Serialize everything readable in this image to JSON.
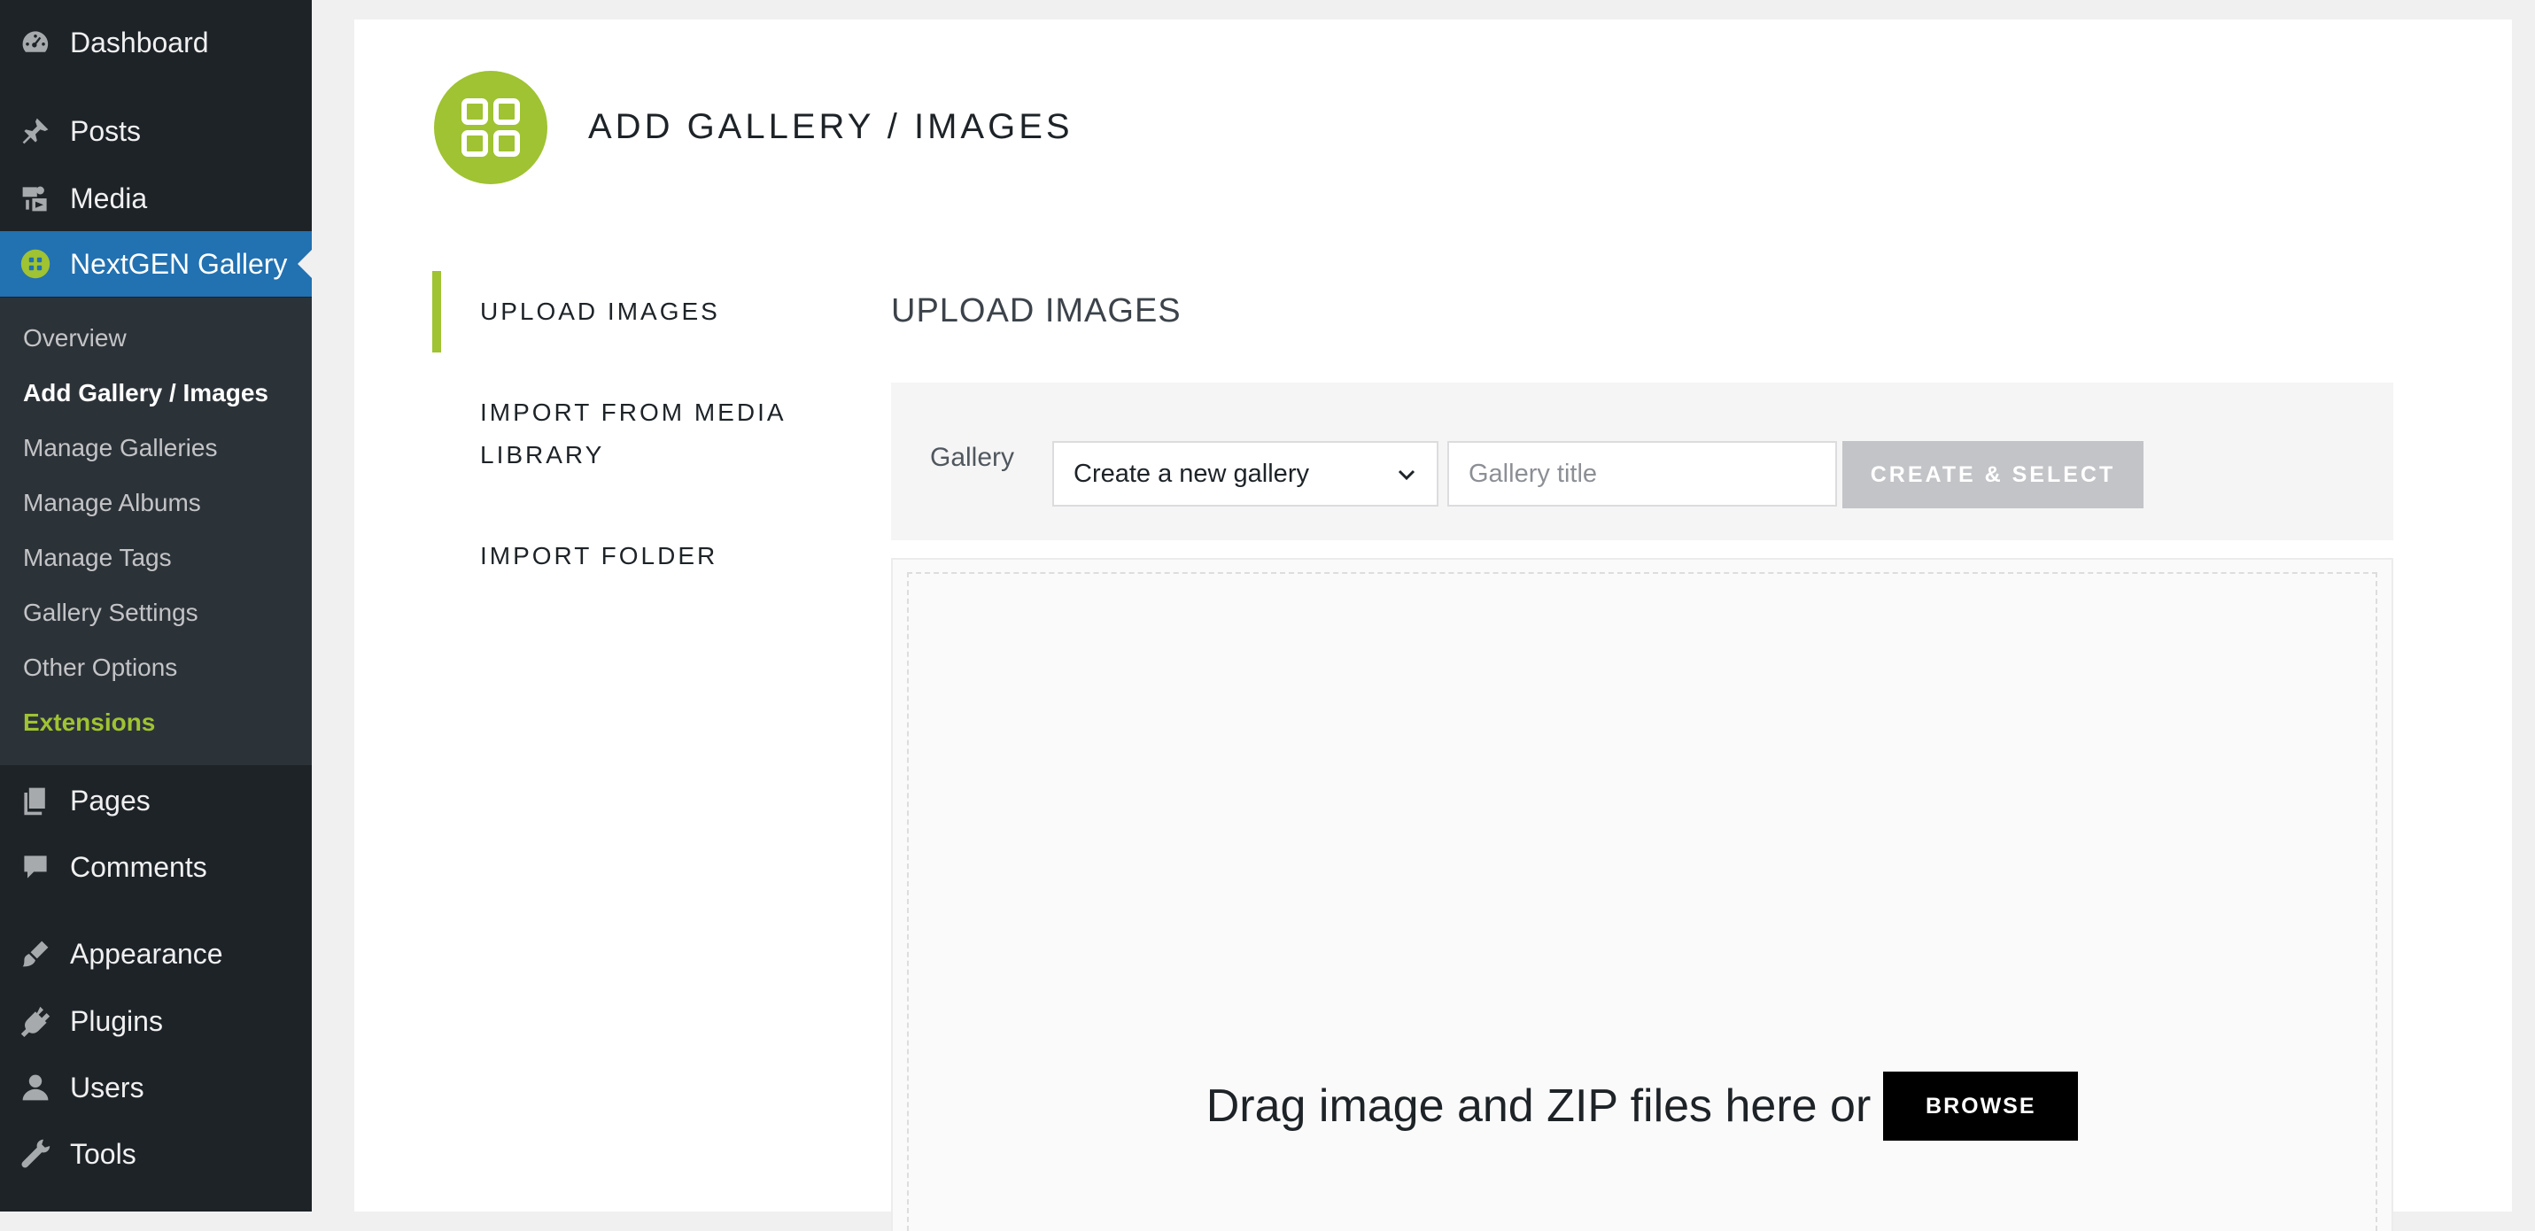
{
  "sidebar": {
    "top_items": [
      {
        "label": "Dashboard",
        "icon": "dashboard-icon"
      },
      {
        "label": "Posts",
        "icon": "pushpin-icon"
      },
      {
        "label": "Media",
        "icon": "media-icon"
      },
      {
        "label": "NextGEN Gallery",
        "icon": "nextgen-icon"
      }
    ],
    "submenu": [
      {
        "label": "Overview"
      },
      {
        "label": "Add Gallery / Images"
      },
      {
        "label": "Manage Galleries"
      },
      {
        "label": "Manage Albums"
      },
      {
        "label": "Manage Tags"
      },
      {
        "label": "Gallery Settings"
      },
      {
        "label": "Other Options"
      },
      {
        "label": "Extensions"
      }
    ],
    "bottom_items": [
      {
        "label": "Pages",
        "icon": "pages-icon"
      },
      {
        "label": "Comments",
        "icon": "comment-icon"
      },
      {
        "label": "Appearance",
        "icon": "brush-icon"
      },
      {
        "label": "Plugins",
        "icon": "plug-icon"
      },
      {
        "label": "Users",
        "icon": "user-icon"
      },
      {
        "label": "Tools",
        "icon": "wrench-icon"
      }
    ]
  },
  "header": {
    "title": "ADD GALLERY / IMAGES",
    "logo_icon": "grid-icon"
  },
  "tabs": [
    {
      "label": "UPLOAD IMAGES"
    },
    {
      "label": "IMPORT FROM MEDIA LIBRARY"
    },
    {
      "label": "IMPORT FOLDER"
    }
  ],
  "main": {
    "section_title": "UPLOAD IMAGES",
    "gallery_label": "Gallery",
    "gallery_select_value": "Create a new gallery",
    "gallery_title_placeholder": "Gallery title",
    "create_button": "CREATE & SELECT",
    "drop_text": "Drag image and ZIP files here or",
    "browse_button": "BROWSE"
  },
  "colors": {
    "sidebar_bg": "#1d2327",
    "active_blue": "#2271b1",
    "accent_green": "#9fc332"
  }
}
